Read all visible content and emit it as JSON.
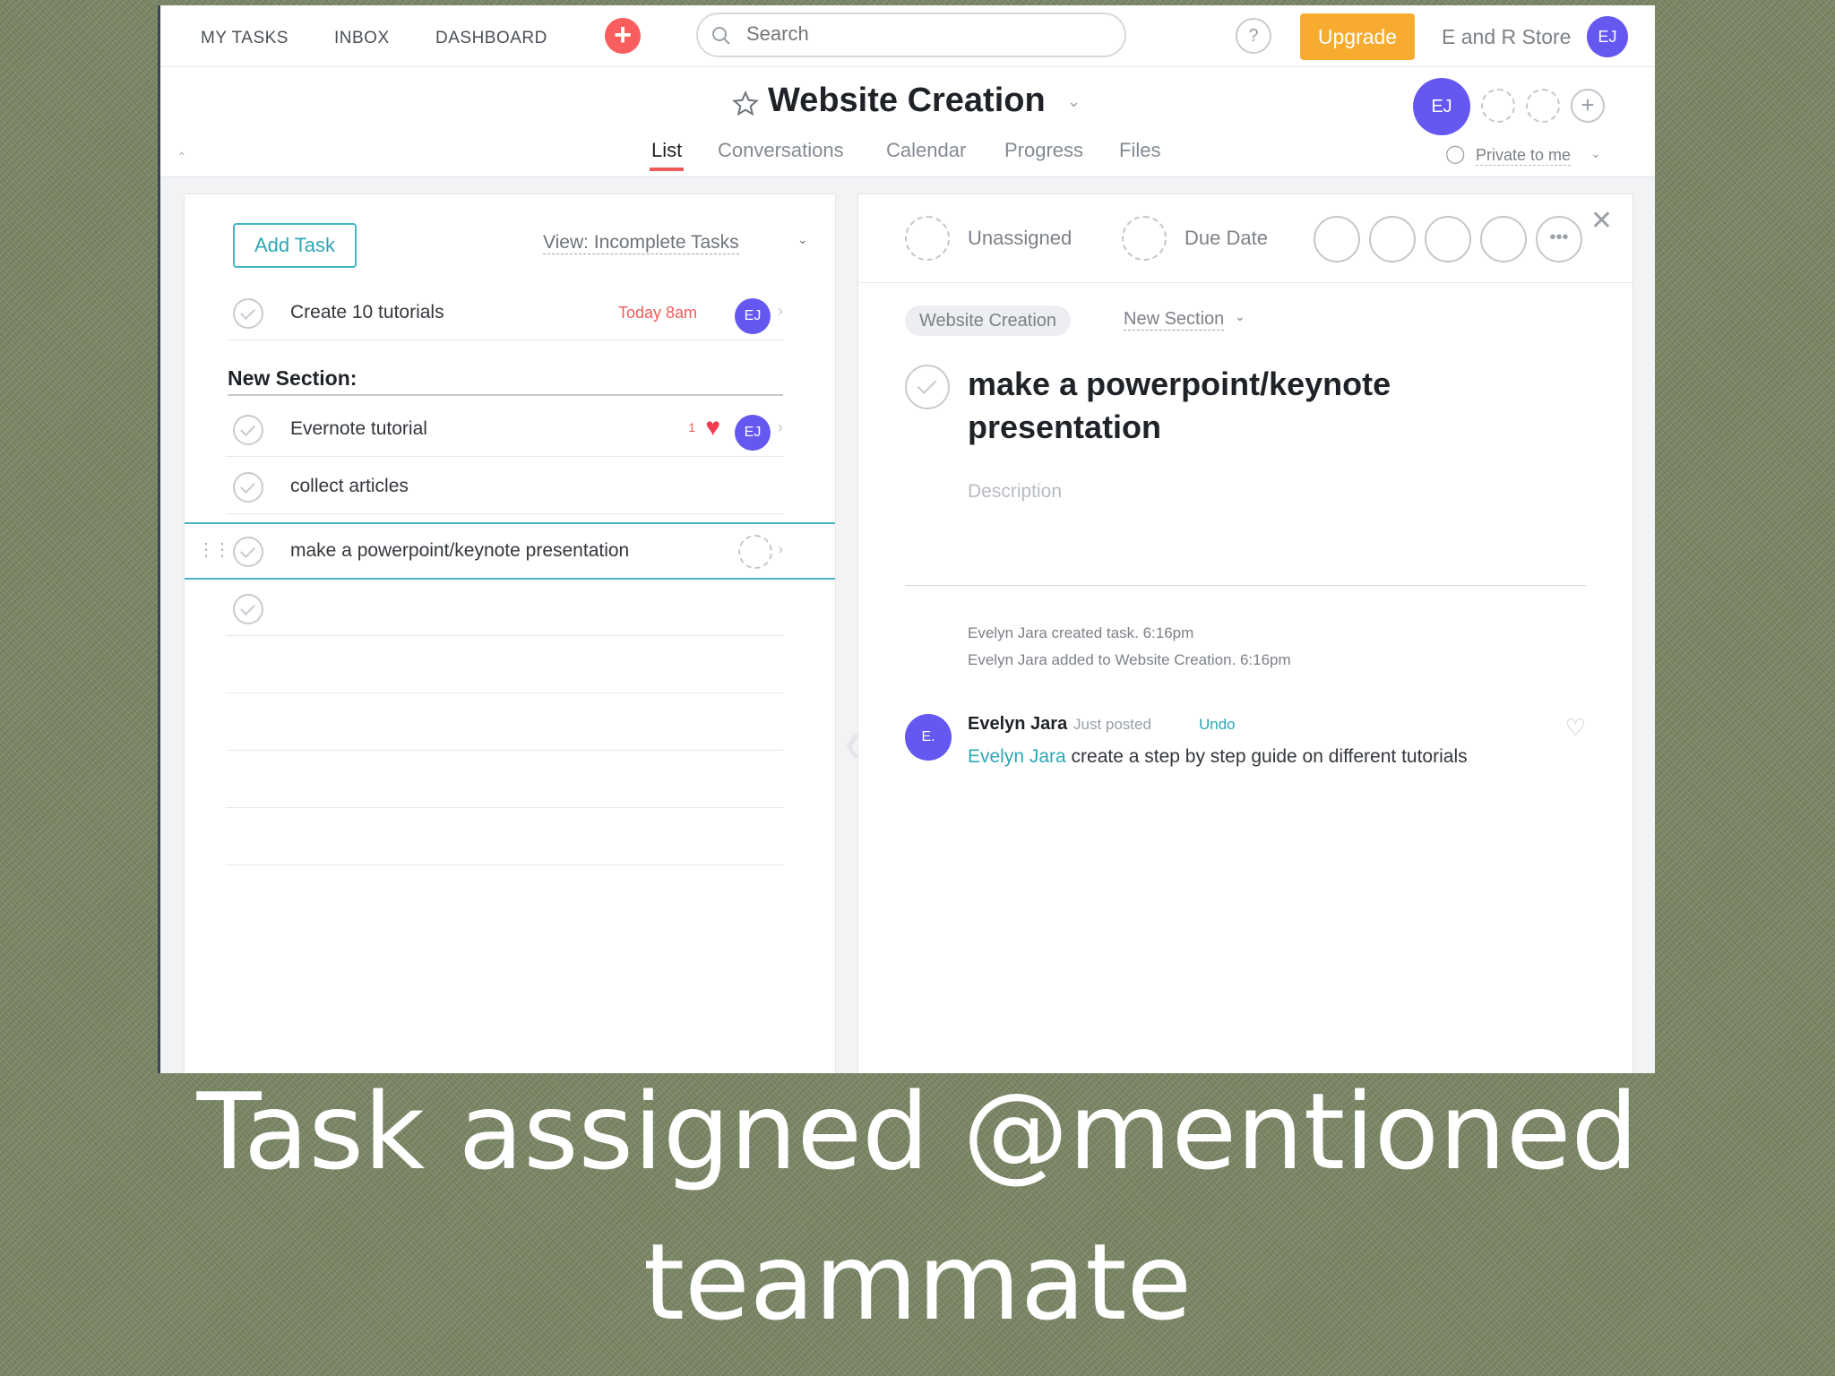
{
  "topbar": {
    "nav": [
      "MY TASKS",
      "INBOX",
      "DASHBOARD"
    ],
    "search_placeholder": "Search",
    "help": "?",
    "upgrade_label": "Upgrade",
    "org_name": "E and R Store",
    "user_initials": "EJ"
  },
  "project": {
    "title": "Website Creation",
    "owner_initials": "EJ",
    "tabs": [
      "List",
      "Conversations",
      "Calendar",
      "Progress",
      "Files"
    ],
    "active_tab": "List",
    "privacy": "Private to me"
  },
  "list": {
    "add_task_label": "Add Task",
    "view_label": "View: Incomplete Tasks",
    "tasks_top": [
      {
        "name": "Create 10 tutorials",
        "due": "Today 8am",
        "assignee": "EJ"
      }
    ],
    "section_name": "New Section:",
    "tasks_section": [
      {
        "name": "Evernote tutorial",
        "likes": "1",
        "assignee": "EJ"
      },
      {
        "name": "collect articles"
      },
      {
        "name": "make a powerpoint/keynote presentation"
      }
    ]
  },
  "detail": {
    "assignee_label": "Unassigned",
    "due_label": "Due Date",
    "project_pill": "Website Creation",
    "section_select": "New Section",
    "task_title": "make a powerpoint/keynote presentation",
    "description_placeholder": "Description",
    "stories": [
      "Evelyn Jara created task.   6:16pm",
      "Evelyn Jara added to Website Creation.   6:16pm"
    ],
    "comment": {
      "avatar_initials": "E.",
      "author": "Evelyn Jara",
      "meta": "Just posted",
      "undo": "Undo",
      "mention": "Evelyn Jara",
      "body": " create a step by step guide on different tutorials"
    }
  },
  "caption": {
    "line1": "Task assigned @mentioned",
    "line2": "teammate"
  },
  "colors": {
    "accent_red": "#f05a5a",
    "upgrade": "#f8ac2f",
    "avatar": "#6458f0",
    "teal": "#2ea7b6",
    "background": "#7b8665"
  }
}
